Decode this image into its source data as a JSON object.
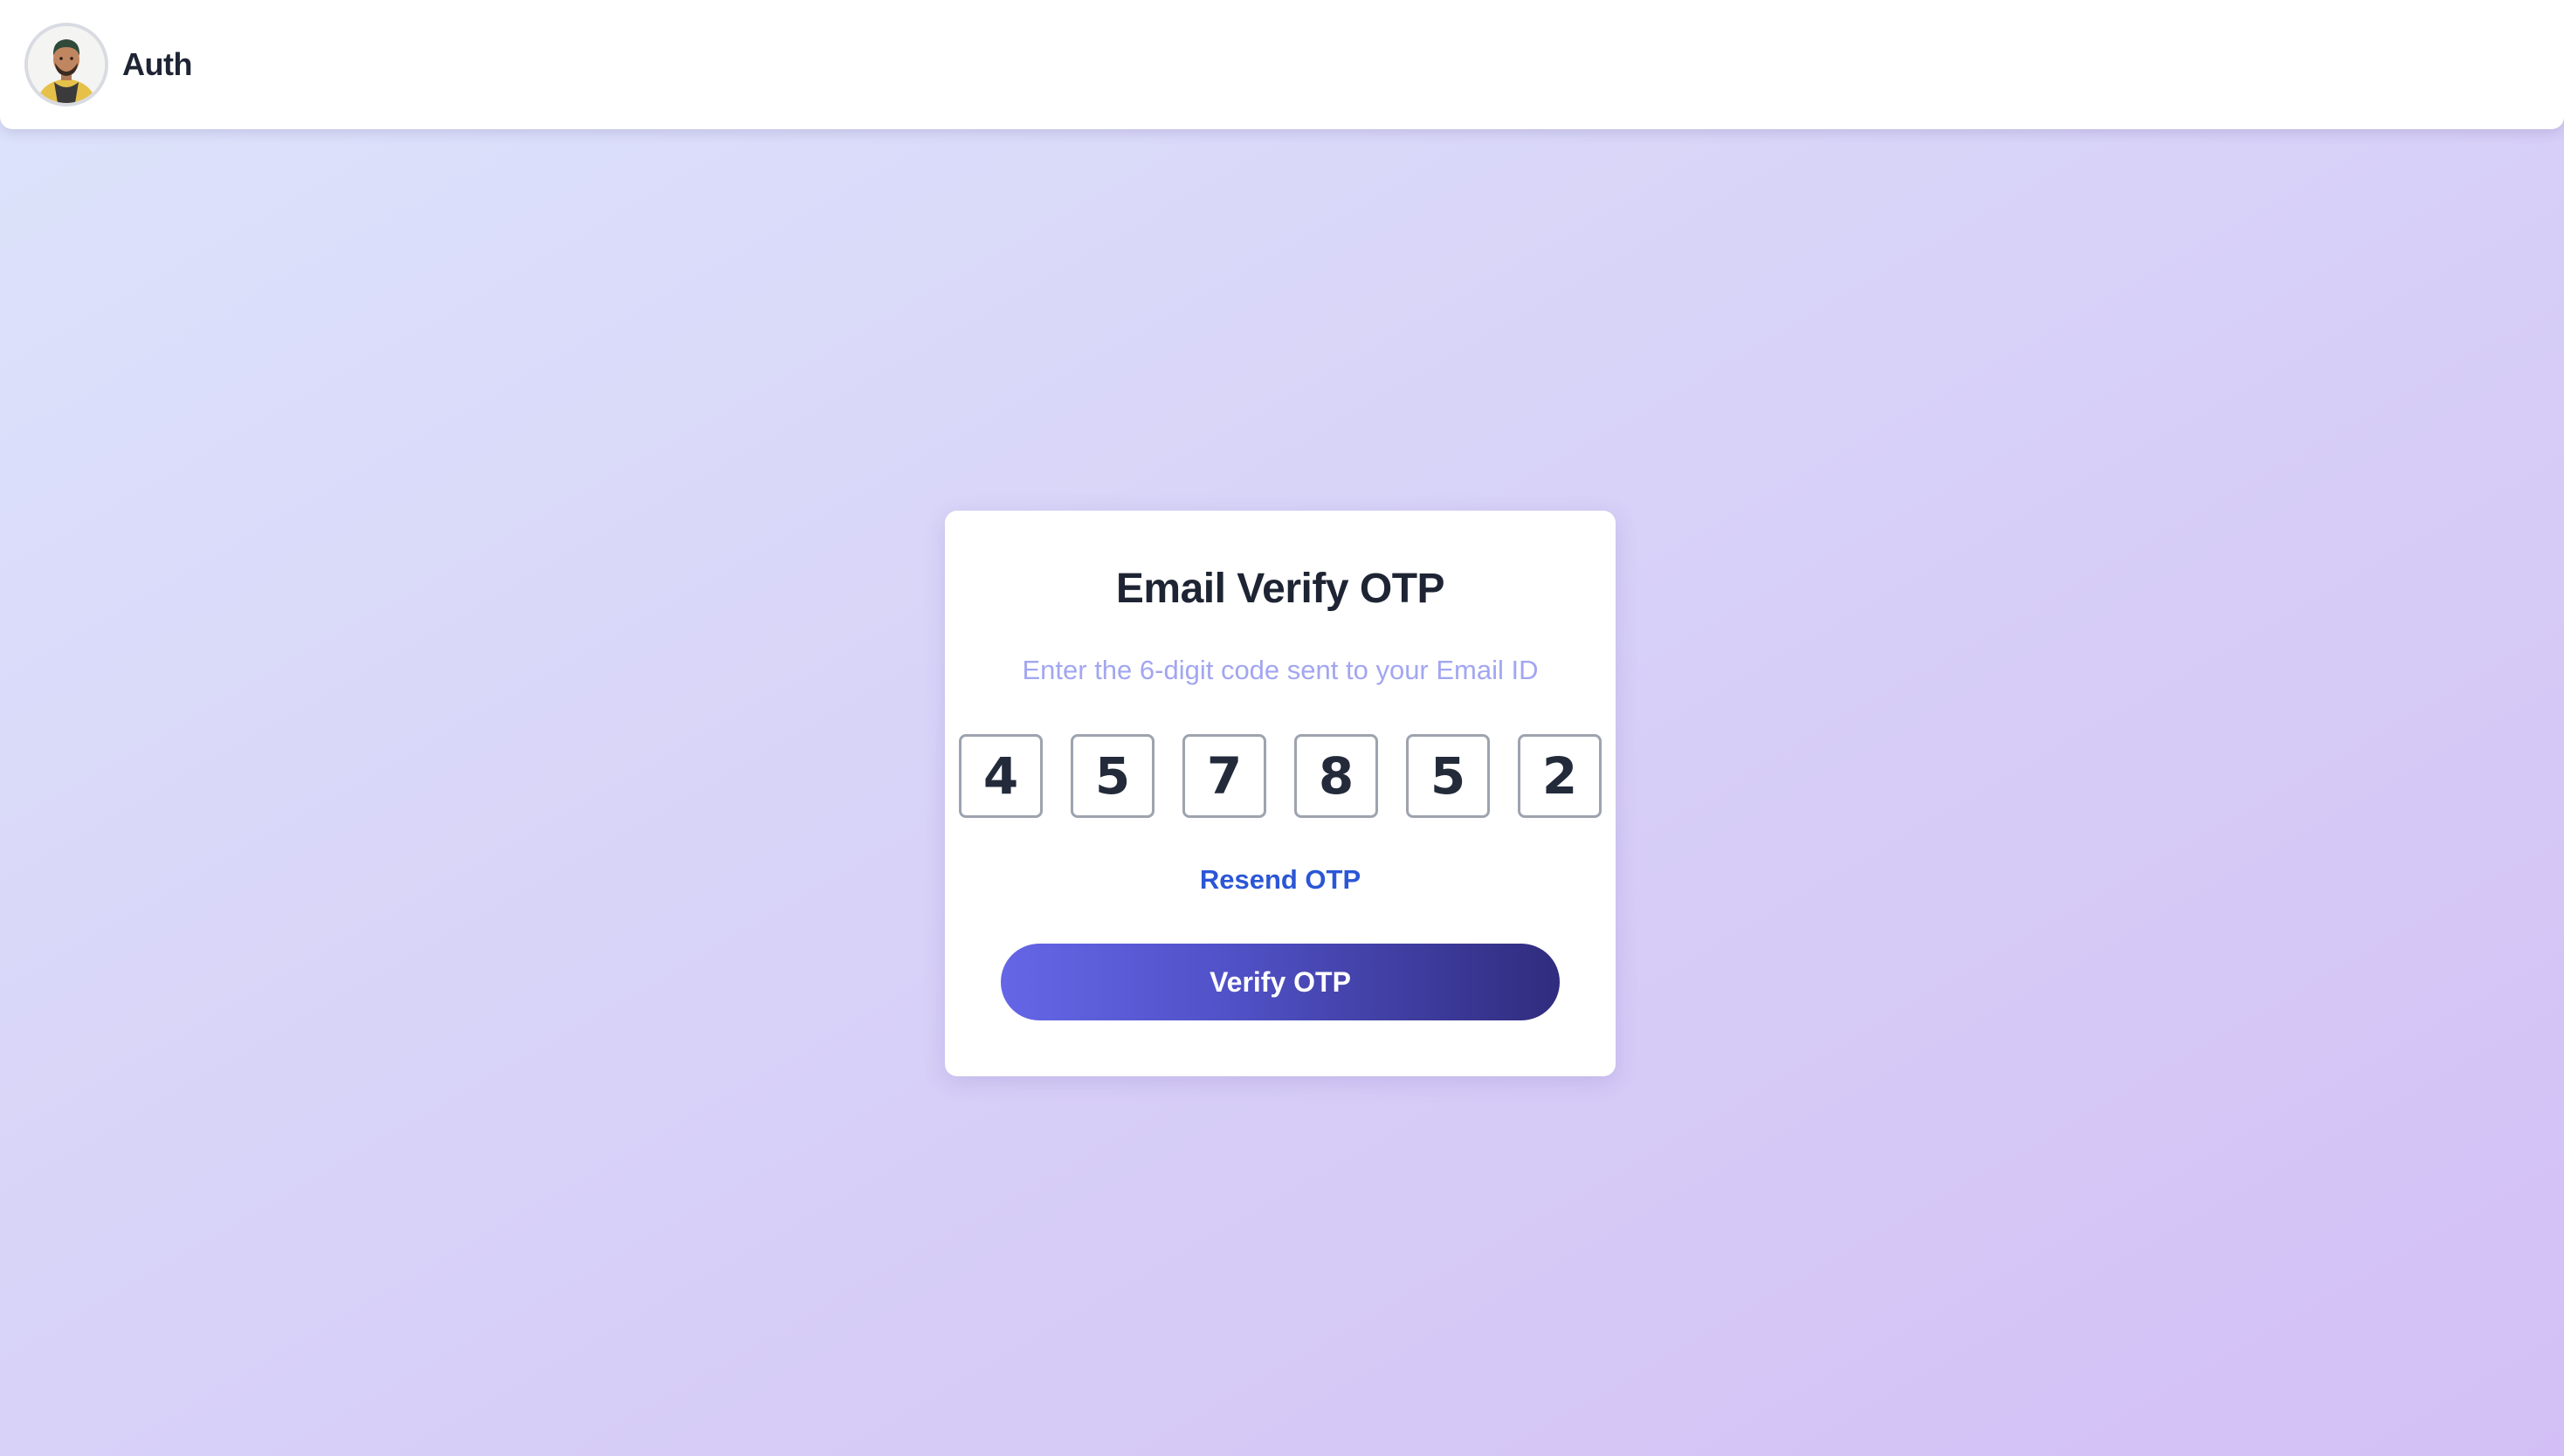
{
  "header": {
    "brand": "Auth",
    "avatar_icon": "user-avatar-icon"
  },
  "card": {
    "title": "Email Verify OTP",
    "subtitle": "Enter the 6-digit code sent to your Email ID",
    "otp_digits": [
      "4",
      "5",
      "7",
      "8",
      "5",
      "2"
    ],
    "resend_label": "Resend OTP",
    "verify_label": "Verify OTP"
  },
  "colors": {
    "accent_start": "#6466e6",
    "accent_end": "#302c7e",
    "link": "#2b56d6",
    "subtitle": "#a2a6f0"
  }
}
